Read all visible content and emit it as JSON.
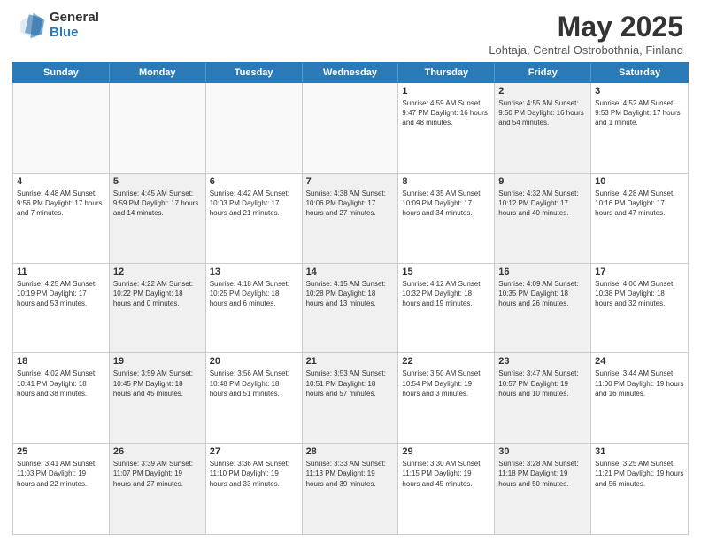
{
  "logo": {
    "general": "General",
    "blue": "Blue"
  },
  "title": "May 2025",
  "subtitle": "Lohtaja, Central Ostrobothnia, Finland",
  "header_days": [
    "Sunday",
    "Monday",
    "Tuesday",
    "Wednesday",
    "Thursday",
    "Friday",
    "Saturday"
  ],
  "weeks": [
    [
      {
        "day": "",
        "info": "",
        "empty": true
      },
      {
        "day": "",
        "info": "",
        "empty": true
      },
      {
        "day": "",
        "info": "",
        "empty": true
      },
      {
        "day": "",
        "info": "",
        "empty": true
      },
      {
        "day": "1",
        "info": "Sunrise: 4:59 AM\nSunset: 9:47 PM\nDaylight: 16 hours\nand 48 minutes."
      },
      {
        "day": "2",
        "info": "Sunrise: 4:55 AM\nSunset: 9:50 PM\nDaylight: 16 hours\nand 54 minutes.",
        "shaded": true
      },
      {
        "day": "3",
        "info": "Sunrise: 4:52 AM\nSunset: 9:53 PM\nDaylight: 17 hours\nand 1 minute."
      }
    ],
    [
      {
        "day": "4",
        "info": "Sunrise: 4:48 AM\nSunset: 9:56 PM\nDaylight: 17 hours\nand 7 minutes."
      },
      {
        "day": "5",
        "info": "Sunrise: 4:45 AM\nSunset: 9:59 PM\nDaylight: 17 hours\nand 14 minutes.",
        "shaded": true
      },
      {
        "day": "6",
        "info": "Sunrise: 4:42 AM\nSunset: 10:03 PM\nDaylight: 17 hours\nand 21 minutes."
      },
      {
        "day": "7",
        "info": "Sunrise: 4:38 AM\nSunset: 10:06 PM\nDaylight: 17 hours\nand 27 minutes.",
        "shaded": true
      },
      {
        "day": "8",
        "info": "Sunrise: 4:35 AM\nSunset: 10:09 PM\nDaylight: 17 hours\nand 34 minutes."
      },
      {
        "day": "9",
        "info": "Sunrise: 4:32 AM\nSunset: 10:12 PM\nDaylight: 17 hours\nand 40 minutes.",
        "shaded": true
      },
      {
        "day": "10",
        "info": "Sunrise: 4:28 AM\nSunset: 10:16 PM\nDaylight: 17 hours\nand 47 minutes."
      }
    ],
    [
      {
        "day": "11",
        "info": "Sunrise: 4:25 AM\nSunset: 10:19 PM\nDaylight: 17 hours\nand 53 minutes."
      },
      {
        "day": "12",
        "info": "Sunrise: 4:22 AM\nSunset: 10:22 PM\nDaylight: 18 hours\nand 0 minutes.",
        "shaded": true
      },
      {
        "day": "13",
        "info": "Sunrise: 4:18 AM\nSunset: 10:25 PM\nDaylight: 18 hours\nand 6 minutes."
      },
      {
        "day": "14",
        "info": "Sunrise: 4:15 AM\nSunset: 10:28 PM\nDaylight: 18 hours\nand 13 minutes.",
        "shaded": true
      },
      {
        "day": "15",
        "info": "Sunrise: 4:12 AM\nSunset: 10:32 PM\nDaylight: 18 hours\nand 19 minutes."
      },
      {
        "day": "16",
        "info": "Sunrise: 4:09 AM\nSunset: 10:35 PM\nDaylight: 18 hours\nand 26 minutes.",
        "shaded": true
      },
      {
        "day": "17",
        "info": "Sunrise: 4:06 AM\nSunset: 10:38 PM\nDaylight: 18 hours\nand 32 minutes."
      }
    ],
    [
      {
        "day": "18",
        "info": "Sunrise: 4:02 AM\nSunset: 10:41 PM\nDaylight: 18 hours\nand 38 minutes."
      },
      {
        "day": "19",
        "info": "Sunrise: 3:59 AM\nSunset: 10:45 PM\nDaylight: 18 hours\nand 45 minutes.",
        "shaded": true
      },
      {
        "day": "20",
        "info": "Sunrise: 3:56 AM\nSunset: 10:48 PM\nDaylight: 18 hours\nand 51 minutes."
      },
      {
        "day": "21",
        "info": "Sunrise: 3:53 AM\nSunset: 10:51 PM\nDaylight: 18 hours\nand 57 minutes.",
        "shaded": true
      },
      {
        "day": "22",
        "info": "Sunrise: 3:50 AM\nSunset: 10:54 PM\nDaylight: 19 hours\nand 3 minutes."
      },
      {
        "day": "23",
        "info": "Sunrise: 3:47 AM\nSunset: 10:57 PM\nDaylight: 19 hours\nand 10 minutes.",
        "shaded": true
      },
      {
        "day": "24",
        "info": "Sunrise: 3:44 AM\nSunset: 11:00 PM\nDaylight: 19 hours\nand 16 minutes."
      }
    ],
    [
      {
        "day": "25",
        "info": "Sunrise: 3:41 AM\nSunset: 11:03 PM\nDaylight: 19 hours\nand 22 minutes."
      },
      {
        "day": "26",
        "info": "Sunrise: 3:39 AM\nSunset: 11:07 PM\nDaylight: 19 hours\nand 27 minutes.",
        "shaded": true
      },
      {
        "day": "27",
        "info": "Sunrise: 3:36 AM\nSunset: 11:10 PM\nDaylight: 19 hours\nand 33 minutes."
      },
      {
        "day": "28",
        "info": "Sunrise: 3:33 AM\nSunset: 11:13 PM\nDaylight: 19 hours\nand 39 minutes.",
        "shaded": true
      },
      {
        "day": "29",
        "info": "Sunrise: 3:30 AM\nSunset: 11:15 PM\nDaylight: 19 hours\nand 45 minutes."
      },
      {
        "day": "30",
        "info": "Sunrise: 3:28 AM\nSunset: 11:18 PM\nDaylight: 19 hours\nand 50 minutes.",
        "shaded": true
      },
      {
        "day": "31",
        "info": "Sunrise: 3:25 AM\nSunset: 11:21 PM\nDaylight: 19 hours\nand 56 minutes."
      }
    ]
  ]
}
